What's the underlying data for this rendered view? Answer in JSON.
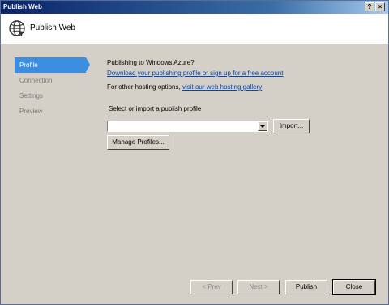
{
  "window": {
    "title": "Publish Web"
  },
  "header": {
    "title": "Publish Web"
  },
  "sidebar": {
    "items": [
      {
        "label": "Profile",
        "active": true
      },
      {
        "label": "Connection",
        "active": false
      },
      {
        "label": "Settings",
        "active": false
      },
      {
        "label": "Preview",
        "active": false
      }
    ]
  },
  "profile": {
    "azure_heading": "Publishing to Windows Azure?",
    "download_link": "Download your publishing profile or sign up for a free account",
    "other_hosting_text": "For other hosting options,",
    "gallery_link": "visit our web hosting gallery",
    "select_label": "Select or import a publish profile",
    "profile_combo_value": "",
    "import_button": "Import...",
    "manage_button": "Manage Profiles..."
  },
  "footer": {
    "prev_button": "< Prev",
    "next_button": "Next >",
    "publish_button": "Publish",
    "close_button": "Close"
  },
  "colors": {
    "accent": "#3c8ede",
    "titlebar": "#0a246a",
    "link": "#0645ad"
  }
}
